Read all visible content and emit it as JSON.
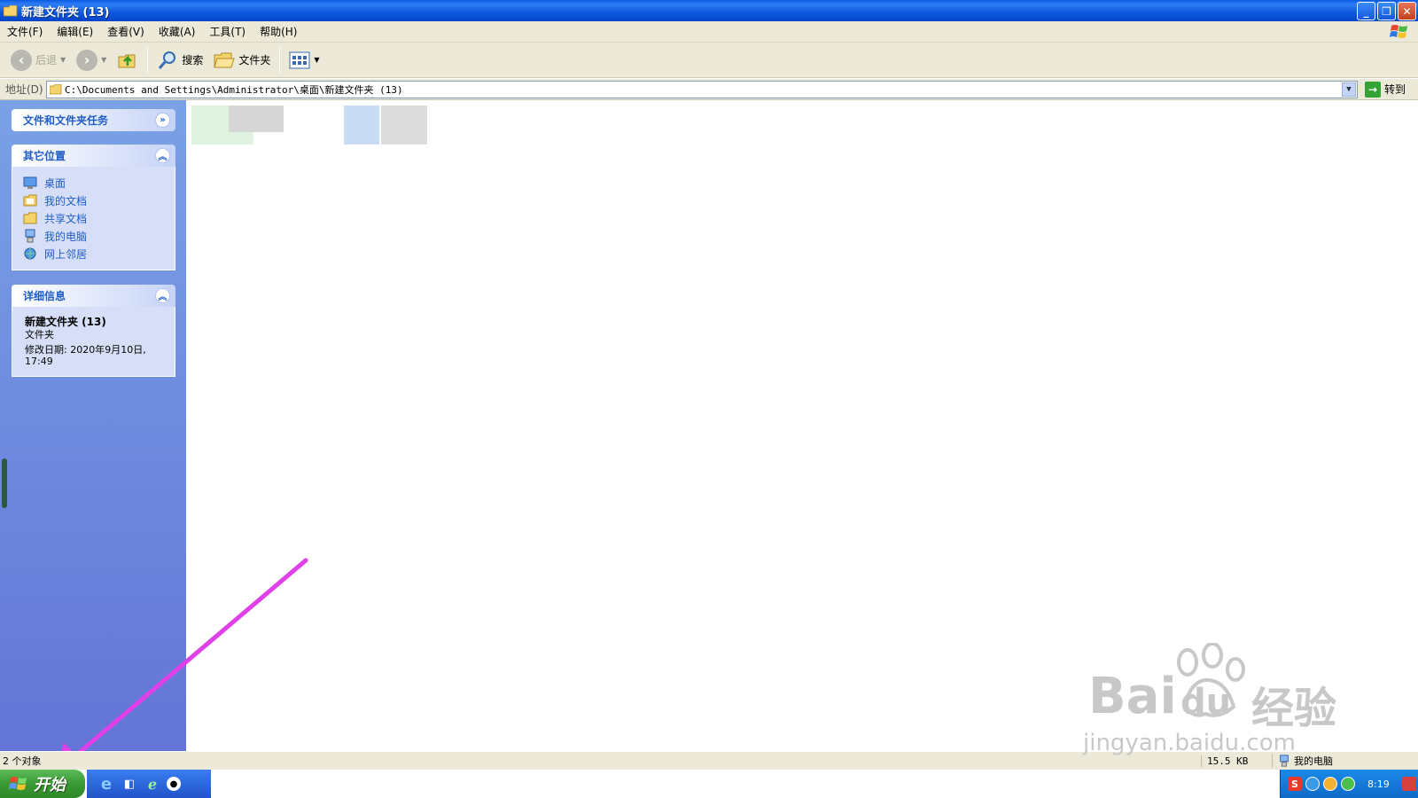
{
  "window": {
    "title": "新建文件夹 (13)",
    "buttons": [
      "minimize",
      "restore",
      "close"
    ]
  },
  "menubar": {
    "items": [
      "文件(F)",
      "编辑(E)",
      "查看(V)",
      "收藏(A)",
      "工具(T)",
      "帮助(H)"
    ]
  },
  "toolbar": {
    "back_label": "后退",
    "search_label": "搜索",
    "folders_label": "文件夹"
  },
  "address": {
    "label": "地址(D)",
    "value": "C:\\Documents and Settings\\Administrator\\桌面\\新建文件夹 (13)",
    "go_label": "转到"
  },
  "taskpane": {
    "file_tasks_title": "文件和文件夹任务",
    "other_places_title": "其它位置",
    "other_places": [
      {
        "label": "桌面",
        "icon": "desktop-icon"
      },
      {
        "label": "我的文档",
        "icon": "my-documents-icon"
      },
      {
        "label": "共享文档",
        "icon": "shared-documents-icon"
      },
      {
        "label": "我的电脑",
        "icon": "my-computer-icon"
      },
      {
        "label": "网上邻居",
        "icon": "network-places-icon"
      }
    ],
    "details_title": "详细信息",
    "details": {
      "name": "新建文件夹 (13)",
      "type": "文件夹",
      "modified_line1": "修改日期: 2020年9月10日,",
      "modified_line2": "17:49"
    }
  },
  "statusbar": {
    "object_count": "2 个对象",
    "size": "15.5 KB",
    "zone": "我的电脑"
  },
  "taskbar": {
    "start_label": "开始",
    "clock": "8:19"
  },
  "watermark": {
    "brand": "Bai",
    "brand2": "du",
    "cn": "经验",
    "url": "jingyan.baidu.com"
  },
  "colors": {
    "titlebar": "#0a5ce4",
    "taskpane_top": "#7aa1e6",
    "taskpane_bottom": "#6375d6",
    "link": "#215dc6",
    "annotation_arrow": "#e040e8",
    "start_green": "#3a9a34"
  }
}
